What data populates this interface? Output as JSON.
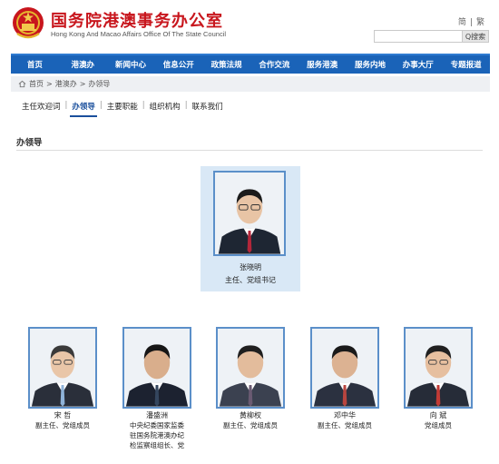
{
  "header": {
    "title": "国务院港澳事务办公室",
    "subtitle": "Hong Kong And Macao Affairs Office Of The State Council",
    "lang_simplified": "简",
    "lang_divider": "|",
    "lang_traditional": "繁",
    "search_placeholder": "",
    "search_button": "Q搜索"
  },
  "nav": {
    "items": [
      "首页",
      "港澳办",
      "新闻中心",
      "信息公开",
      "政策法规",
      "合作交流",
      "服务港澳",
      "服务内地",
      "办事大厅",
      "专题报道"
    ]
  },
  "breadcrumb": {
    "home": "首页",
    "sep1": ">",
    "level1": "港澳办",
    "sep2": ">",
    "current": "办领导"
  },
  "subtabs": {
    "items": [
      "主任欢迎词",
      "办领导",
      "主要职能",
      "组织机构",
      "联系我们"
    ],
    "active": "办领导"
  },
  "section": {
    "title": "办领导"
  },
  "leader": {
    "name": "张晓明",
    "title": "主任、党组书记"
  },
  "members": [
    {
      "name": "宋  哲",
      "role_lines": [
        "副主任、党组成员"
      ]
    },
    {
      "name": "潘盛洲",
      "role_lines": [
        "中央纪委国家监委",
        "驻国务院港澳办纪",
        "检监察组组长、党"
      ]
    },
    {
      "name": "黄柳权",
      "role_lines": [
        "副主任、党组成员"
      ]
    },
    {
      "name": "邓中华",
      "role_lines": [
        "副主任、党组成员"
      ]
    },
    {
      "name": "向  斌",
      "role_lines": [
        "党组成员"
      ]
    }
  ],
  "colors": {
    "brand_red": "#c8161d",
    "nav_blue": "#1a63b8",
    "photo_border": "#5b8fc9",
    "leader_card_bg": "#d9e8f6"
  },
  "icons": {
    "emblem": "national-emblem-icon",
    "home": "home-icon",
    "search": "search-icon"
  }
}
